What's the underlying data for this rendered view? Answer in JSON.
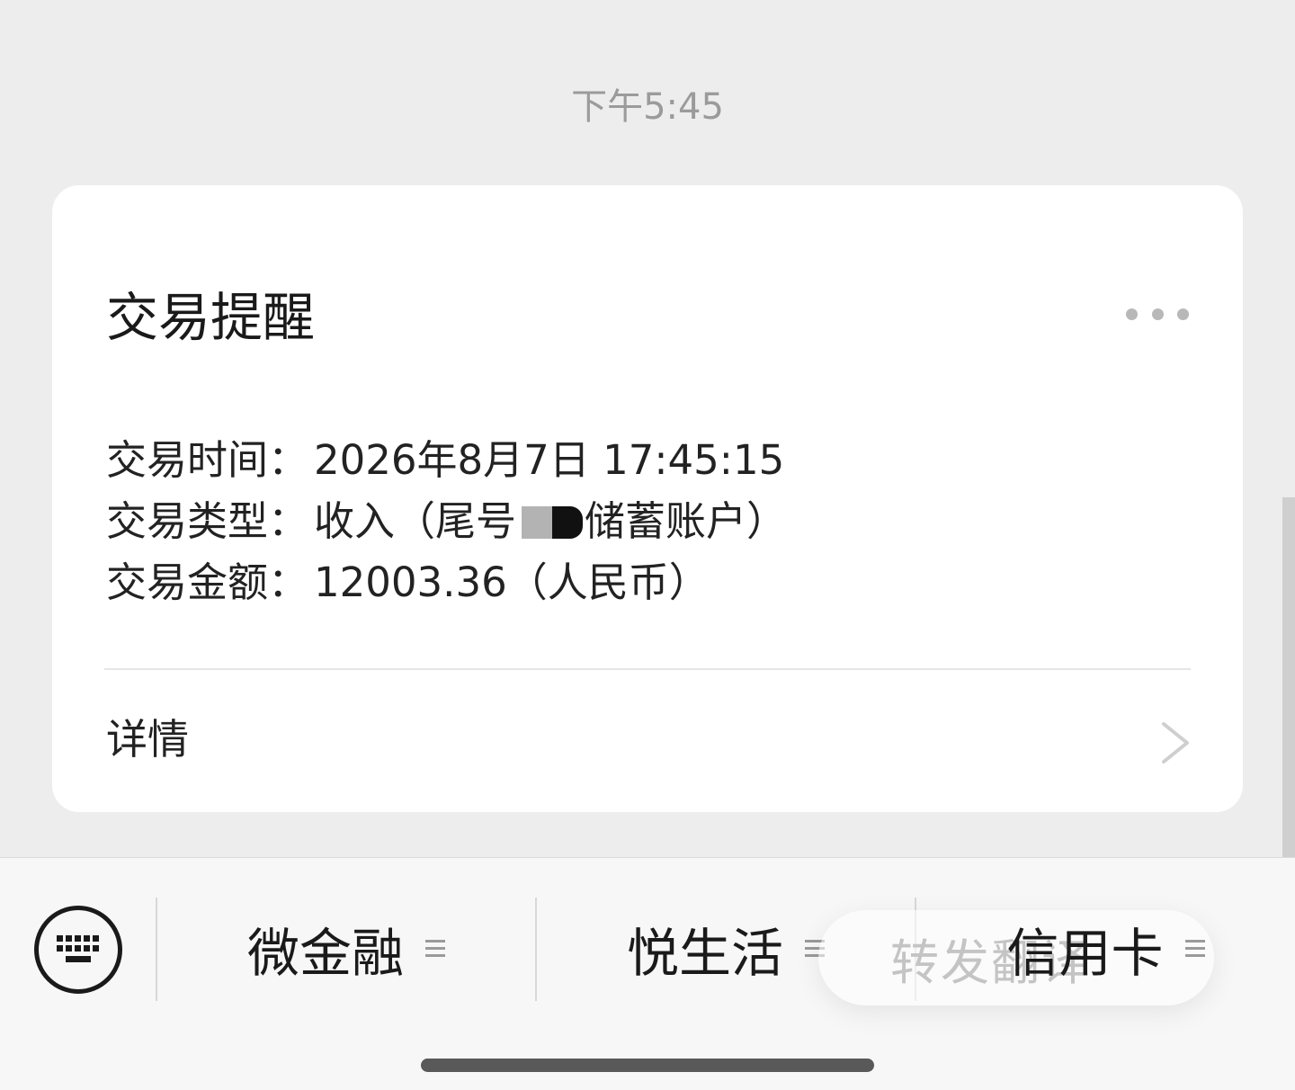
{
  "timestamp": "下午5:45",
  "card": {
    "title": "交易提醒",
    "more_icon": "more-dots-icon",
    "rows": [
      {
        "label": "交易时间：",
        "value": "2026年8月7日 17:45:15"
      },
      {
        "label": "交易类型：",
        "value_prefix": "收入（尾号",
        "value_suffix": "储蓄账户）"
      },
      {
        "label": "交易金额：",
        "value": "12003.36（人民币）"
      }
    ],
    "detail_label": "详情",
    "detail_icon": "chevron-right-icon"
  },
  "bottom_menu": {
    "keyboard_icon": "keyboard-icon",
    "items": [
      {
        "label": "微金融",
        "icon": "menu-lines-icon"
      },
      {
        "label": "悦生活",
        "icon": "menu-lines-icon"
      },
      {
        "label": "信用卡",
        "icon": "menu-lines-icon"
      }
    ],
    "toast": "转发翻译"
  },
  "colors": {
    "background": "#ededed",
    "card": "#ffffff",
    "bottom_bar": "#f7f7f7"
  }
}
